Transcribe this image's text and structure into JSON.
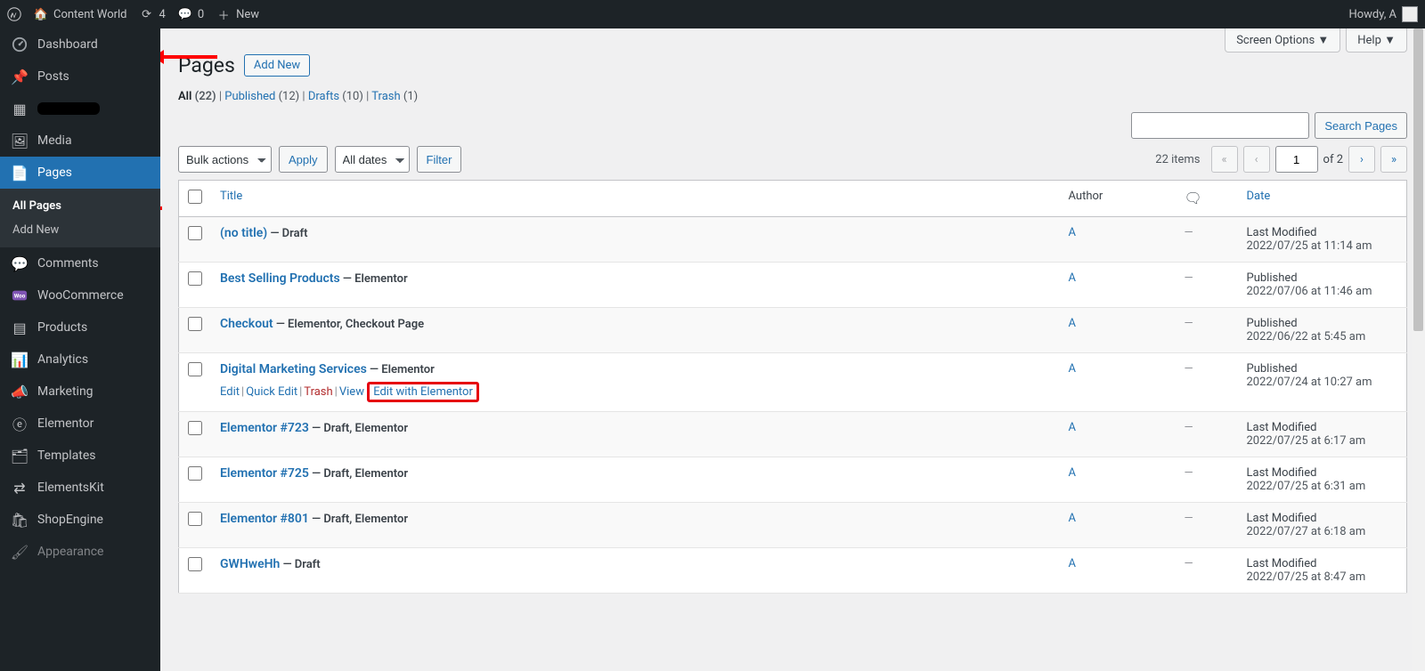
{
  "adminbar": {
    "site_name": "Content World",
    "updates": "4",
    "comments": "0",
    "new": "New",
    "howdy": "Howdy, A"
  },
  "sidebar": {
    "dashboard": "Dashboard",
    "posts": "Posts",
    "redacted": "",
    "media": "Media",
    "pages": "Pages",
    "all_pages": "All Pages",
    "add_new": "Add New",
    "comments": "Comments",
    "woocommerce": "WooCommerce",
    "products": "Products",
    "analytics": "Analytics",
    "marketing": "Marketing",
    "elementor": "Elementor",
    "templates": "Templates",
    "elementskit": "ElementsKit",
    "shopengine": "ShopEngine",
    "appearance": "Appearance"
  },
  "screen_meta": {
    "screen_options": "Screen Options",
    "help": "Help"
  },
  "heading": {
    "title": "Pages",
    "add_new": "Add New"
  },
  "filters": {
    "all": "All",
    "all_count": "(22)",
    "published": "Published",
    "published_count": "(12)",
    "drafts": "Drafts",
    "drafts_count": "(10)",
    "trash": "Trash",
    "trash_count": "(1)",
    "sep": " | "
  },
  "search": {
    "button": "Search Pages"
  },
  "bulk": {
    "bulk_actions": "Bulk actions",
    "apply": "Apply",
    "all_dates": "All dates",
    "filter": "Filter"
  },
  "pagination": {
    "items": "22 items",
    "current": "1",
    "of": " of 2 ",
    "first": "«",
    "prev": "‹",
    "next": "›",
    "last": "»"
  },
  "columns": {
    "title": "Title",
    "author": "Author",
    "date": "Date"
  },
  "row_actions": {
    "edit": "Edit",
    "quick_edit": "Quick Edit",
    "trash": "Trash",
    "view": "View",
    "edit_elementor": "Edit with Elementor"
  },
  "state_prefix": " — ",
  "rows": [
    {
      "title": "(no title)",
      "state": "Draft",
      "author": "A",
      "comments": "—",
      "date_status": "Last Modified",
      "date": "2022/07/25 at 11:14 am",
      "show_actions": false
    },
    {
      "title": "Best Selling Products",
      "state": "Elementor",
      "author": "A",
      "comments": "—",
      "date_status": "Published",
      "date": "2022/07/06 at 11:46 am",
      "show_actions": false
    },
    {
      "title": "Checkout",
      "state": "Elementor, Checkout Page",
      "author": "A",
      "comments": "—",
      "date_status": "Published",
      "date": "2022/06/22 at 5:45 am",
      "show_actions": false
    },
    {
      "title": "Digital Marketing Services",
      "state": "Elementor",
      "author": "A",
      "comments": "—",
      "date_status": "Published",
      "date": "2022/07/24 at 10:27 am",
      "show_actions": true
    },
    {
      "title": "Elementor #723",
      "state": "Draft, Elementor",
      "author": "A",
      "comments": "—",
      "date_status": "Last Modified",
      "date": "2022/07/25 at 6:17 am",
      "show_actions": false
    },
    {
      "title": "Elementor #725",
      "state": "Draft, Elementor",
      "author": "A",
      "comments": "—",
      "date_status": "Last Modified",
      "date": "2022/07/25 at 6:31 am",
      "show_actions": false
    },
    {
      "title": "Elementor #801",
      "state": "Draft, Elementor",
      "author": "A",
      "comments": "—",
      "date_status": "Last Modified",
      "date": "2022/07/27 at 6:18 am",
      "show_actions": false
    },
    {
      "title": "GWHweHh",
      "state": "Draft",
      "author": "A",
      "comments": "—",
      "date_status": "Last Modified",
      "date": "2022/07/25 at 8:47 am",
      "show_actions": false
    }
  ]
}
